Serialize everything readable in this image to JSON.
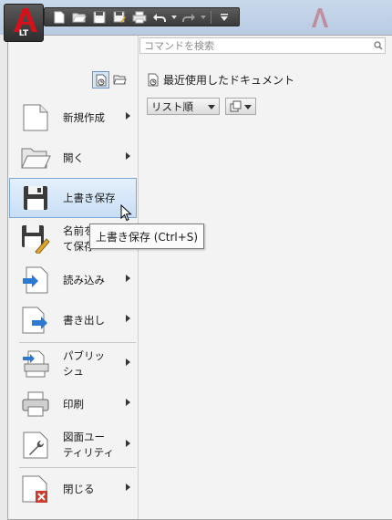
{
  "app": {
    "badge": "LT",
    "brand_color": "#c0141c"
  },
  "qat": {
    "buttons": [
      "new-icon",
      "open-icon",
      "save-icon",
      "saveas-icon",
      "print-icon",
      "undo-icon",
      "redo-icon",
      "customize-icon"
    ]
  },
  "search": {
    "placeholder": "コマンドを検索",
    "value": ""
  },
  "menu": {
    "items": [
      {
        "label": "新規作成",
        "icon": "new-document-icon",
        "has_submenu": true
      },
      {
        "label": "開く",
        "icon": "open-folder-icon",
        "has_submenu": true
      },
      {
        "label": "上書き保存",
        "icon": "save-icon",
        "has_submenu": false,
        "highlighted": true
      },
      {
        "label": "名前を付けて保存",
        "label_visible_line1": "名前を付",
        "label_visible_line2": "て保存",
        "icon": "save-as-icon",
        "has_submenu": true
      },
      {
        "label": "読み込み",
        "icon": "import-icon",
        "has_submenu": true
      },
      {
        "label": "書き出し",
        "icon": "export-icon",
        "has_submenu": true
      },
      {
        "label": "パブリッシュ",
        "label_line1": "パブリッ",
        "label_line2": "シュ",
        "icon": "publish-icon",
        "has_submenu": true
      },
      {
        "label": "印刷",
        "icon": "print-icon",
        "has_submenu": true
      },
      {
        "label": "図面ユーティリティ",
        "label_line1": "図面ユー",
        "label_line2": "ティリティ",
        "icon": "drawing-utilities-icon",
        "has_submenu": true
      },
      {
        "label": "閉じる",
        "icon": "close-document-icon",
        "has_submenu": true
      }
    ]
  },
  "recent": {
    "title": "最近使用したドキュメント",
    "sort_value": "リスト順",
    "view_icon": "view-mode-icon"
  },
  "tooltip": {
    "text": "上書き保存 (Ctrl+S)"
  },
  "colors": {
    "highlight_bg": "#d5e6f8",
    "highlight_border": "#7aa7d7",
    "accent_blue": "#2b79d1"
  }
}
